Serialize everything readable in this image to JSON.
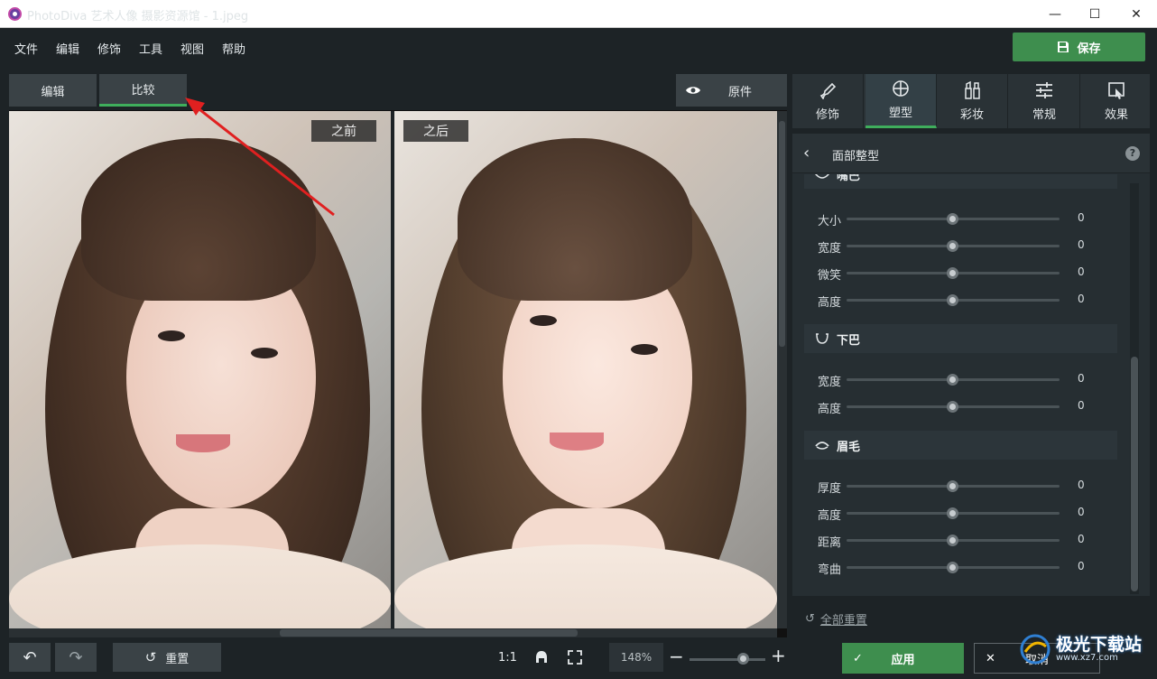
{
  "window": {
    "title": "PhotoDiva 艺术人像 摄影资源馆 - 1.jpeg",
    "minimize": "—",
    "maximize": "☐",
    "close": "✕"
  },
  "menu": {
    "items": [
      "文件",
      "编辑",
      "修饰",
      "工具",
      "视图",
      "帮助"
    ],
    "save_label": "保存"
  },
  "view_tabs": {
    "edit": "编辑",
    "compare": "比较",
    "original": "原件"
  },
  "compare": {
    "before_label": "之前",
    "after_label": "之后"
  },
  "tools": [
    {
      "label": "修饰",
      "icon": "brush-icon"
    },
    {
      "label": "塑型",
      "icon": "reshape-icon"
    },
    {
      "label": "彩妆",
      "icon": "makeup-icon"
    },
    {
      "label": "常规",
      "icon": "sliders-icon"
    },
    {
      "label": "效果",
      "icon": "effects-icon"
    }
  ],
  "panel": {
    "title": "面部整型",
    "help": "?",
    "partial_section": "嘴巴",
    "mouth_sliders": [
      {
        "label": "大小",
        "value": "0",
        "level": 0.5
      },
      {
        "label": "宽度",
        "value": "0",
        "level": 0.5
      },
      {
        "label": "微笑",
        "value": "0",
        "level": 0.5
      },
      {
        "label": "高度",
        "value": "0",
        "level": 0.5
      }
    ],
    "chin": {
      "title": "下巴",
      "sliders": [
        {
          "label": "宽度",
          "value": "0",
          "level": 0.5
        },
        {
          "label": "高度",
          "value": "0",
          "level": 0.5
        }
      ]
    },
    "eyebrows": {
      "title": "眉毛",
      "sliders": [
        {
          "label": "厚度",
          "value": "0",
          "level": 0.5
        },
        {
          "label": "高度",
          "value": "0",
          "level": 0.5
        },
        {
          "label": "距离",
          "value": "0",
          "level": 0.5
        },
        {
          "label": "弯曲",
          "value": "0",
          "level": 0.5
        }
      ]
    },
    "reset_all": "全部重置"
  },
  "bottom": {
    "reset": "重置",
    "ratio": "1:1",
    "zoom": "148%",
    "zoom_level": 0.7,
    "apply": "应用",
    "cancel": "取消"
  },
  "watermark": {
    "text": "极光下载站",
    "url": "www.xz7.com"
  },
  "colors": {
    "accent_green": "#3e8e4e",
    "tab_underline": "#3fae5c",
    "annotation_arrow": "#e02020"
  }
}
